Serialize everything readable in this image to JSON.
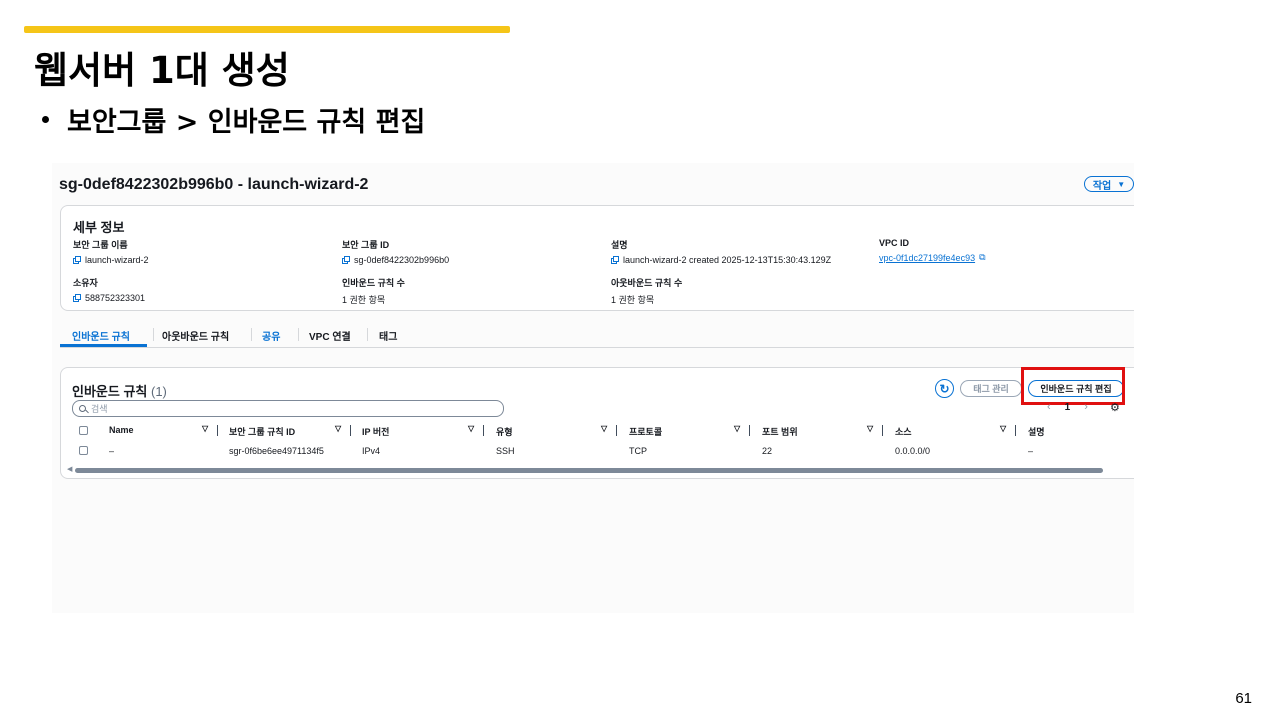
{
  "slide": {
    "title": "웹서버 1대 생성",
    "bullet": "보안그룹 > 인바운드 규칙 편집",
    "page_number": "61",
    "accent_color": "#f5c518"
  },
  "header": {
    "title": "sg-0def8422302b996b0 - launch-wizard-2",
    "actions_label": "작업",
    "actions_icon": "caret-down-icon"
  },
  "details": {
    "title": "세부 정보",
    "fields": [
      {
        "label": "보안 그룹 이름",
        "value": "launch-wizard-2"
      },
      {
        "label": "보안 그룹 ID",
        "value": "sg-0def8422302b996b0"
      },
      {
        "label": "설명",
        "value": "launch-wizard-2 created 2025-12-13T15:30:43.129Z"
      },
      {
        "label": "VPC ID",
        "value": "vpc-0f1dc27199fe4ec93"
      },
      {
        "label": "소유자",
        "value": "588752323301"
      },
      {
        "label": "인바운드 규칙 수",
        "value": "1 권한 항목"
      },
      {
        "label": "아웃바운드 규칙 수",
        "value": "1 권한 항목"
      }
    ]
  },
  "tabs": [
    {
      "label": "인바운드 규칙",
      "active": true
    },
    {
      "label": "아웃바운드 규칙"
    },
    {
      "label": "공유"
    },
    {
      "label": "VPC 연결"
    },
    {
      "label": "태그"
    }
  ],
  "rules": {
    "title": "인바운드 규칙",
    "count": "(1)",
    "manage_tags_label": "태그 관리",
    "edit_rules_label": "인바운드 규칙 편집",
    "search_placeholder": "검색",
    "page": "1",
    "highlight_color": "#e01010",
    "columns": [
      "Name",
      "보안 그룹 규칙 ID",
      "IP 버전",
      "유형",
      "프로토콜",
      "포트 범위",
      "소스",
      "설명"
    ],
    "rows": [
      [
        "–",
        "sgr-0f6be6ee4971134f5",
        "IPv4",
        "SSH",
        "TCP",
        "22",
        "0.0.0.0/0",
        "–"
      ]
    ]
  }
}
